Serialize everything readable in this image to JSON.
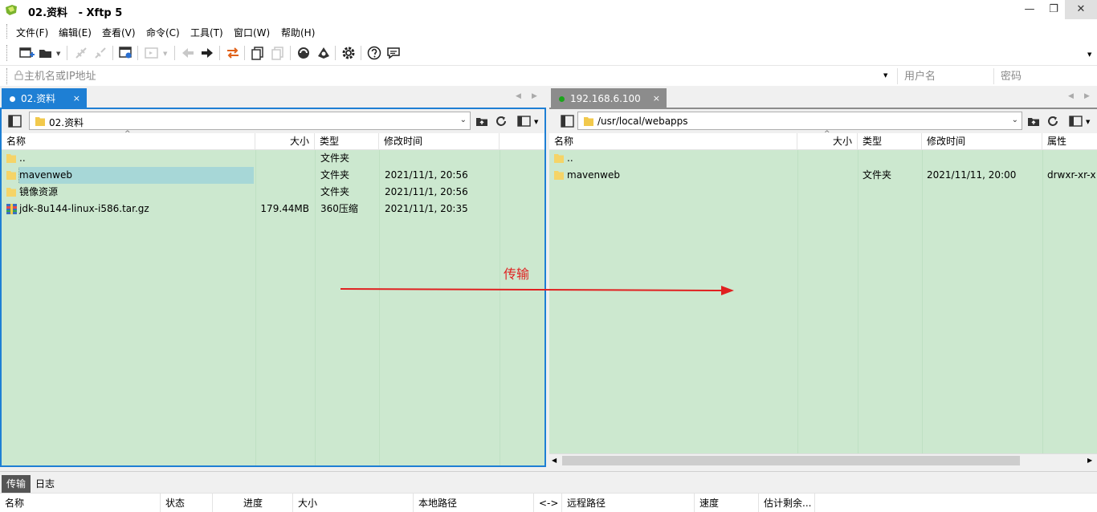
{
  "window": {
    "title": "02.资料   - Xftp 5",
    "minimize": "—",
    "maximize": "❐",
    "close": "✕"
  },
  "menu": [
    "文件(F)",
    "编辑(E)",
    "查看(V)",
    "命令(C)",
    "工具(T)",
    "窗口(W)",
    "帮助(H)"
  ],
  "address": {
    "host_placeholder": "主机名或IP地址",
    "user_placeholder": "用户名",
    "pass_placeholder": "密码"
  },
  "left": {
    "tab_label": "02.资料",
    "tab_close": "×",
    "path": "02.资料",
    "columns": [
      "名称",
      "大小",
      "类型",
      "修改时间"
    ],
    "files": [
      {
        "name": "..",
        "size": "",
        "type": "文件夹",
        "modified": "",
        "icon": "folder-icon"
      },
      {
        "name": "mavenweb",
        "size": "",
        "type": "文件夹",
        "modified": "2021/11/1, 20:56",
        "icon": "folder-icon",
        "selected": true
      },
      {
        "name": "镜像资源",
        "size": "",
        "type": "文件夹",
        "modified": "2021/11/1, 20:56",
        "icon": "folder-icon"
      },
      {
        "name": "jdk-8u144-linux-i586.tar.gz",
        "size": "179.44MB",
        "type": "360压缩",
        "modified": "2021/11/1, 20:35",
        "icon": "archive-icon"
      }
    ]
  },
  "right": {
    "tab_label": "192.168.6.100",
    "tab_close": "×",
    "path": "/usr/local/webapps",
    "columns": [
      "名称",
      "大小",
      "类型",
      "修改时间",
      "属性"
    ],
    "files": [
      {
        "name": "..",
        "size": "",
        "type": "",
        "modified": "",
        "attrs": "",
        "icon": "folder-icon"
      },
      {
        "name": "mavenweb",
        "size": "",
        "type": "文件夹",
        "modified": "2021/11/11, 20:00",
        "attrs": "drwxr-xr-x",
        "icon": "folder-icon"
      }
    ]
  },
  "annotation": {
    "label": "传输",
    "color": "#e02020"
  },
  "bottom": {
    "tabs": [
      "传输",
      "日志"
    ],
    "columns": [
      "名称",
      "状态",
      "进度",
      "大小",
      "本地路径",
      "<->",
      "远程路径",
      "速度",
      "估计剩余..."
    ]
  },
  "colors": {
    "accent": "#1e7fd4",
    "list_bg": "#cce8cf",
    "connected_dot": "#1aa51a"
  }
}
